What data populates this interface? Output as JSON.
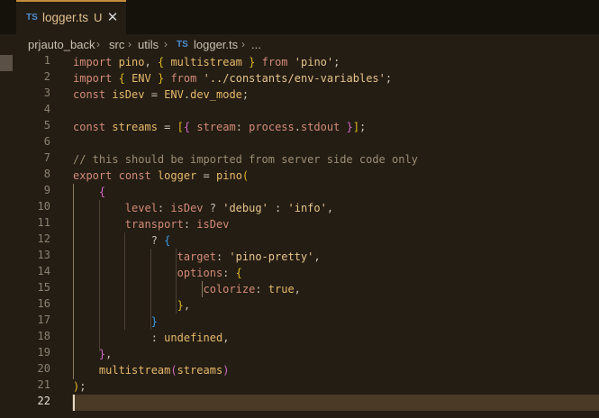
{
  "tab": {
    "lang": "TS",
    "filename": "logger.ts",
    "status": "U",
    "close": "✕"
  },
  "breadcrumb": {
    "items": [
      "prjauto_back",
      "src",
      "utils"
    ],
    "file_lang": "TS",
    "file": "logger.ts",
    "more": "..."
  },
  "colors": {
    "accent": "#c48c3c",
    "keyword": "#d58b76",
    "variable": "#e8b96a",
    "string": "#e8c48a",
    "comment": "#9d8d75",
    "bracket1": "#e2b81e",
    "bracket2": "#d26ac6",
    "bracket3": "#3c9ae6"
  },
  "editor": {
    "active_line": 22,
    "line_numbers": [
      "1",
      "2",
      "3",
      "4",
      "5",
      "6",
      "7",
      "8",
      "9",
      "10",
      "11",
      "12",
      "13",
      "14",
      "15",
      "16",
      "17",
      "18",
      "19",
      "20",
      "21",
      "22"
    ],
    "code": {
      "l1": {
        "import": "import",
        "pino": "pino",
        "comma": ",",
        "ob": "{",
        "multistream": "multistream",
        "cb": "}",
        "from": "from",
        "src": "'pino'",
        "semi": ";"
      },
      "l2": {
        "import": "import",
        "ob": "{",
        "env": "ENV",
        "cb": "}",
        "from": "from",
        "src": "'../constants/env-variables'",
        "semi": ";"
      },
      "l3": {
        "const": "const",
        "isdev": "isDev",
        "eq": "=",
        "env": "ENV",
        "dot": ".",
        "prop": "dev_mode",
        "semi": ";"
      },
      "l5": {
        "const": "const",
        "streams": "streams",
        "eq": "=",
        "ob1": "[",
        "ob2": "{",
        "stream": "stream",
        "colon": ":",
        "process": "process",
        "dot": ".",
        "stdout": "stdout",
        "cb2": "}",
        "cb1": "]",
        "semi": ";"
      },
      "l7": {
        "comment": "// this should be imported from server side code only"
      },
      "l8": {
        "export": "export",
        "const": "const",
        "logger": "logger",
        "eq": "=",
        "pino": "pino",
        "op": "("
      },
      "l9": {
        "ob": "{"
      },
      "l10": {
        "level": "level",
        "colon": ":",
        "isdev": "isDev",
        "q": "?",
        "debug": "'debug'",
        "colon2": ":",
        "info": "'info'",
        "comma": ","
      },
      "l11": {
        "transport": "transport",
        "colon": ":",
        "isdev": "isDev"
      },
      "l12": {
        "q": "?",
        "ob": "{"
      },
      "l13": {
        "target": "target",
        "colon": ":",
        "val": "'pino-pretty'",
        "comma": ","
      },
      "l14": {
        "options": "options",
        "colon": ":",
        "ob": "{"
      },
      "l15": {
        "colorize": "colorize",
        "colon": ":",
        "val": "true",
        "comma": ","
      },
      "l16": {
        "cb": "}",
        "comma": ","
      },
      "l17": {
        "cb": "}"
      },
      "l18": {
        "colon": ":",
        "val": "undefined",
        "comma": ","
      },
      "l19": {
        "cb": "}",
        "comma": ","
      },
      "l20": {
        "fn": "multistream",
        "op": "(",
        "arg": "streams",
        "cp": ")"
      },
      "l21": {
        "cp": ")",
        "semi": ";"
      }
    }
  }
}
